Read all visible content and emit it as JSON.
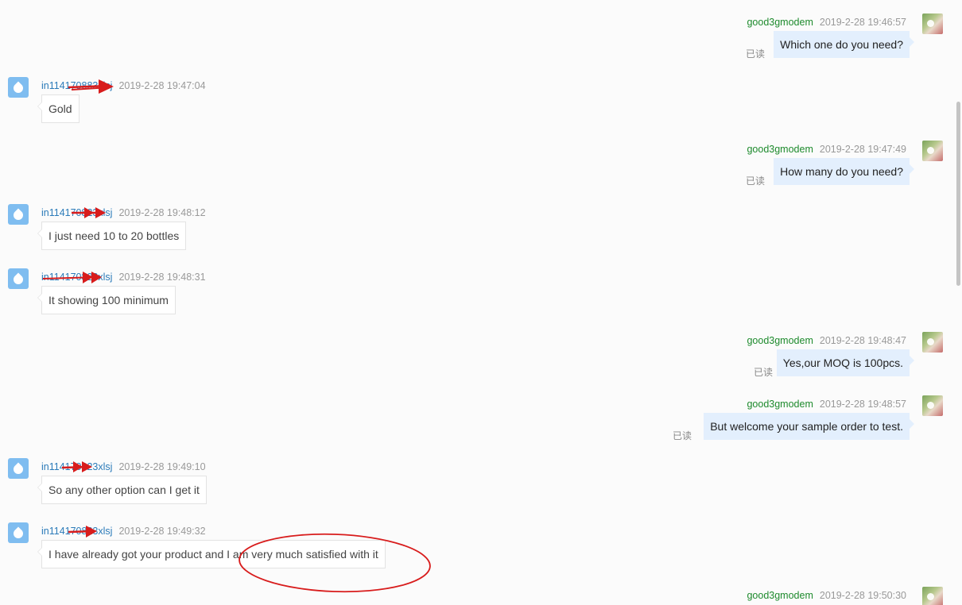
{
  "conversation": {
    "m1": {
      "sender": "good3gmodem",
      "time": "2019-2-28 19:46:57",
      "text": "Which one do you need?",
      "status": "已读"
    },
    "m2": {
      "sender": "in114170883xlsj",
      "time": "2019-2-28 19:47:04",
      "text": "Gold"
    },
    "m3": {
      "sender": "good3gmodem",
      "time": "2019-2-28 19:47:49",
      "text": "How many do you need?",
      "status": "已读"
    },
    "m4": {
      "sender": "in114170823xlsj",
      "time": "2019-2-28 19:48:12",
      "text": "I just need 10 to 20 bottles"
    },
    "m5": {
      "sender": "in114170823xlsj",
      "time": "2019-2-28 19:48:31",
      "text": "It showing 100 minimum"
    },
    "m6": {
      "sender": "good3gmodem",
      "time": "2019-2-28 19:48:47",
      "text": "Yes,our MOQ is 100pcs.",
      "status": "已读"
    },
    "m7": {
      "sender": "good3gmodem",
      "time": "2019-2-28 19:48:57",
      "text": "But welcome your sample order to test.",
      "status": "已读"
    },
    "m8": {
      "sender": "in114170823xlsj",
      "time": "2019-2-28 19:49:10",
      "text": "So any other option can I get it"
    },
    "m9": {
      "sender": "in114170823xlsj",
      "time": "2019-2-28 19:49:32",
      "text": "I have already got your product and I am very much satisfied with it"
    },
    "m10": {
      "sender": "good3gmodem",
      "time": "2019-2-28 19:50:30"
    }
  },
  "colors": {
    "seller_name": "#1d8a2c",
    "buyer_name": "#2b7bb9",
    "outgoing_bubble": "#e3effd",
    "annotation_red": "#d81c1c"
  },
  "icons": {
    "buyer_avatar": "droplet-avatar-icon",
    "seller_avatar": "flower-photo-avatar-icon",
    "annotation_arrow": "red-arrow-icon"
  }
}
